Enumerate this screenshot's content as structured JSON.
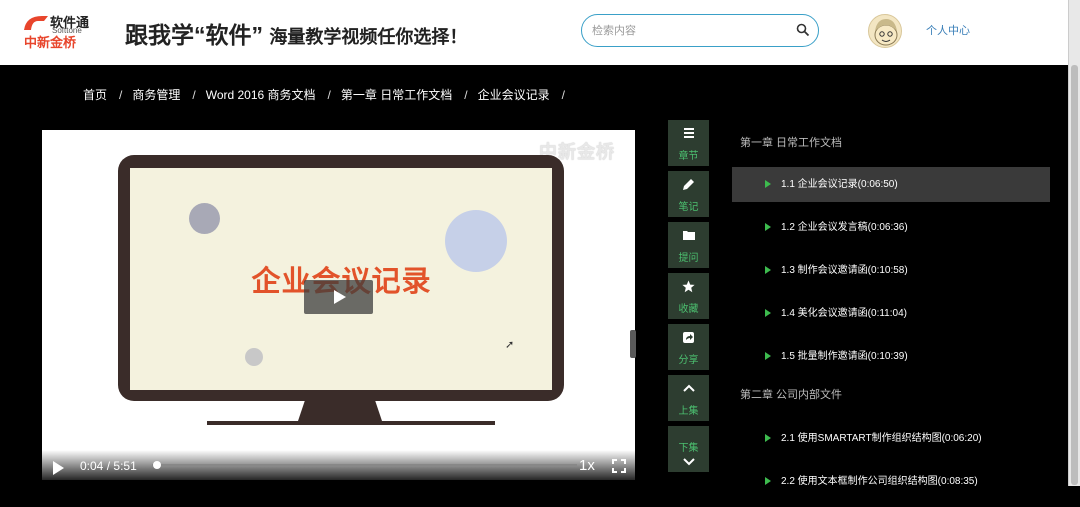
{
  "header": {
    "brand_top": "软件通",
    "brand_sub": "Softtone",
    "brand_cn": "中新金桥",
    "slogan_main": "跟我学“软件”",
    "slogan_rest": "海量教学视频任你选择！",
    "search_placeholder": "检索内容",
    "user_link": "个人中心"
  },
  "breadcrumb": [
    "首页",
    "商务管理",
    "Word 2016 商务文档",
    "第一章 日常工作文档",
    "企业会议记录"
  ],
  "breadcrumb_sep": "/",
  "player": {
    "watermark": "中新金桥",
    "slide_title": "企业会议记录",
    "current_time": "0:04",
    "time_sep": "/",
    "duration": "5:51",
    "speed": "1x",
    "progress_fraction": 0.011
  },
  "tools": [
    {
      "label": "章节",
      "icon": "list-icon"
    },
    {
      "label": "笔记",
      "icon": "pencil-icon"
    },
    {
      "label": "提问",
      "icon": "folder-icon"
    },
    {
      "label": "收藏",
      "icon": "star-icon"
    },
    {
      "label": "分享",
      "icon": "share-icon"
    },
    {
      "label": "上集",
      "icon": "chevron-up-icon"
    },
    {
      "label": "下集",
      "icon": "chevron-down-icon"
    }
  ],
  "chapters": [
    {
      "title": "第一章 日常工作文档",
      "lessons": [
        {
          "label": "1.1 企业会议记录(0:06:50)",
          "active": true
        },
        {
          "label": "1.2 企业会议发言稿(0:06:36)",
          "active": false
        },
        {
          "label": "1.3 制作会议邀请函(0:10:58)",
          "active": false
        },
        {
          "label": "1.4 美化会议邀请函(0:11:04)",
          "active": false
        },
        {
          "label": "1.5 批量制作邀请函(0:10:39)",
          "active": false
        }
      ]
    },
    {
      "title": "第二章 公司内部文件",
      "lessons": [
        {
          "label": "2.1 使用SMARTART制作组织结构图(0:06:20)",
          "active": false
        },
        {
          "label": "2.2 使用文本框制作公司组织结构图(0:08:35)",
          "active": false
        }
      ]
    }
  ],
  "colors": {
    "accent_green": "#3dbb4e",
    "search_border": "#3aa0c8",
    "slide_title": "#e2532a",
    "tool_bg": "#2d3d30"
  }
}
